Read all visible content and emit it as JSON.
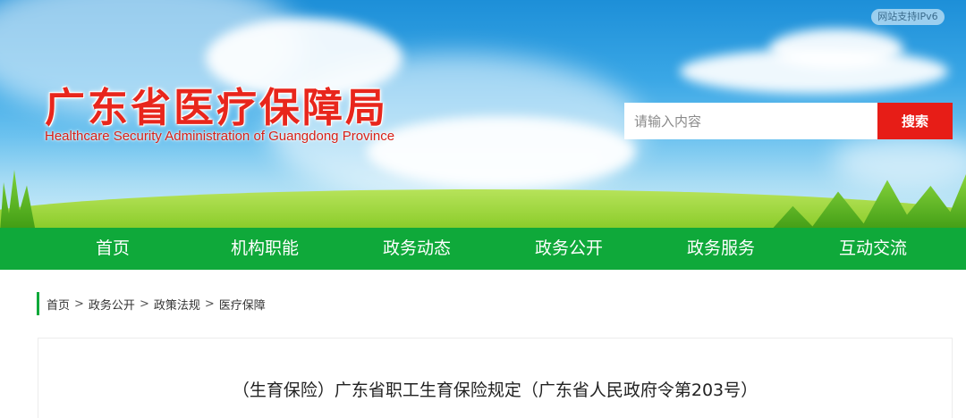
{
  "header": {
    "ipv6_badge": "网站支持IPv6",
    "logo_cn": "广东省医疗保障局",
    "logo_en": "Healthcare Security Administration of Guangdong Province"
  },
  "search": {
    "placeholder": "请输入内容",
    "value": "",
    "button_label": "搜索"
  },
  "nav": {
    "items": [
      {
        "label": "首页"
      },
      {
        "label": "机构职能"
      },
      {
        "label": "政务动态"
      },
      {
        "label": "政务公开"
      },
      {
        "label": "政务服务"
      },
      {
        "label": "互动交流"
      }
    ]
  },
  "breadcrumb": {
    "items": [
      "首页",
      "政务公开",
      "政策法规",
      "医疗保障"
    ],
    "separator": ">"
  },
  "article": {
    "title": "（生育保险）广东省职工生育保险规定（广东省人民政府令第203号）"
  },
  "colors": {
    "nav_green": "#0fa93a",
    "brand_red": "#e8261c",
    "search_button_red": "#e71d17"
  }
}
